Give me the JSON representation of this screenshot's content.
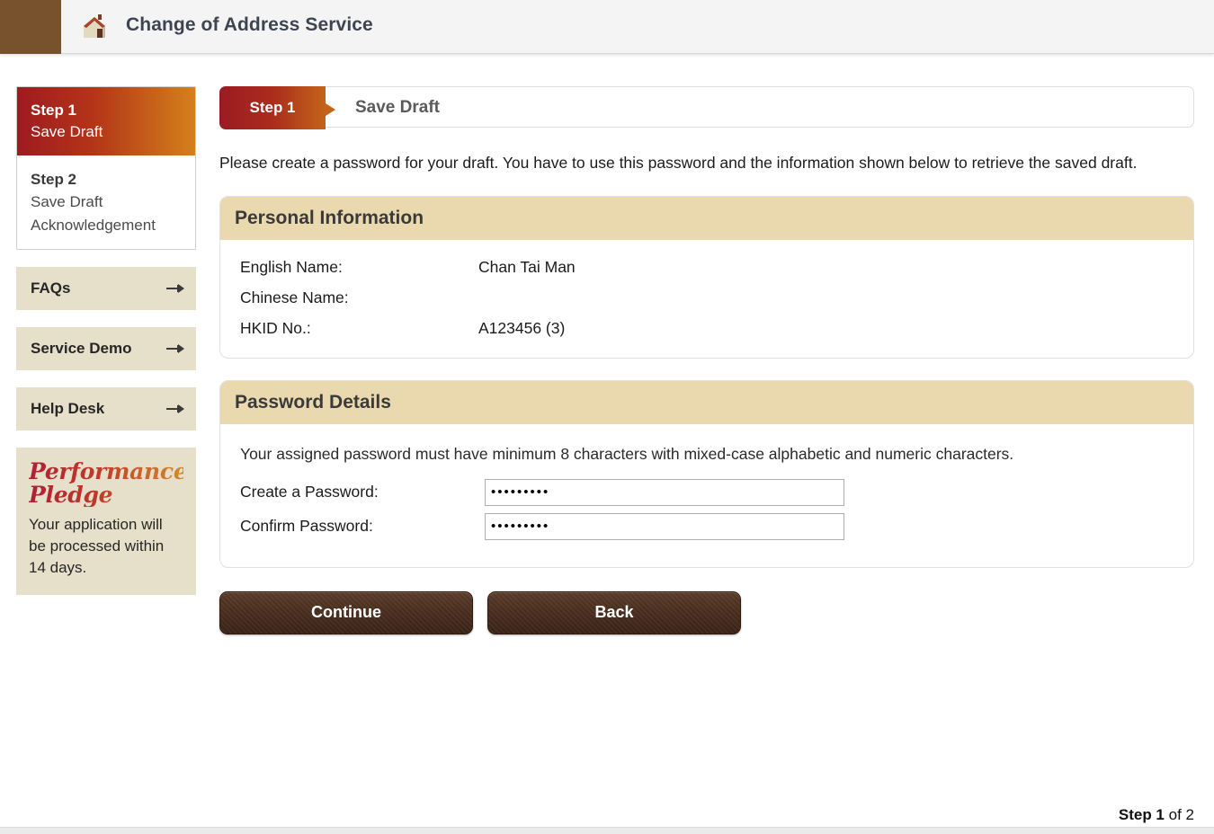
{
  "header": {
    "title": "Change of Address Service",
    "icon": "house-icon",
    "block_color": "#77522c",
    "background": "#f4f4f4"
  },
  "sidebar": {
    "steps": [
      {
        "number": "Step 1",
        "description": "Save Draft",
        "active": true
      },
      {
        "number": "Step 2",
        "description": "Save Draft Acknowledgement",
        "active": false
      }
    ],
    "links": [
      {
        "label": "FAQs",
        "icon": "expand-arrow-icon"
      },
      {
        "label": "Service Demo",
        "icon": "expand-arrow-icon"
      },
      {
        "label": "Help Desk",
        "icon": "expand-arrow-icon"
      }
    ],
    "pledge": {
      "title_line1": "Performance",
      "title_line2": "Pledge",
      "text": "Your application will be processed within 14 days.",
      "gradient_start": "#b02034",
      "gradient_end": "#d4892a",
      "background": "#e6e0ca"
    }
  },
  "main": {
    "stepbar": {
      "tab_label": "Step 1",
      "title": "Save Draft"
    },
    "intro": "Please create a password for your draft. You have to use this password and the information shown below to retrieve the saved draft.",
    "personal_information": {
      "heading": "Personal Information",
      "rows": [
        {
          "label": "English Name:",
          "value": "Chan Tai Man"
        },
        {
          "label": "Chinese Name:",
          "value": ""
        },
        {
          "label": "HKID No.:",
          "value": "A123456 (3)"
        }
      ]
    },
    "password_details": {
      "heading": "Password Details",
      "note": "Your assigned password must have minimum 8 characters with mixed-case alphabetic and numeric characters.",
      "fields": [
        {
          "label": "Create a Password:",
          "value": "•••••••••",
          "placeholder": ""
        },
        {
          "label": "Confirm Password:",
          "value": "•••••••••",
          "placeholder": ""
        }
      ]
    },
    "buttons": [
      {
        "label": "Continue",
        "name": "continue-button"
      },
      {
        "label": "Back",
        "name": "back-button"
      }
    ]
  },
  "footer": {
    "step_current": "Step 1",
    "step_total": " of 2"
  }
}
